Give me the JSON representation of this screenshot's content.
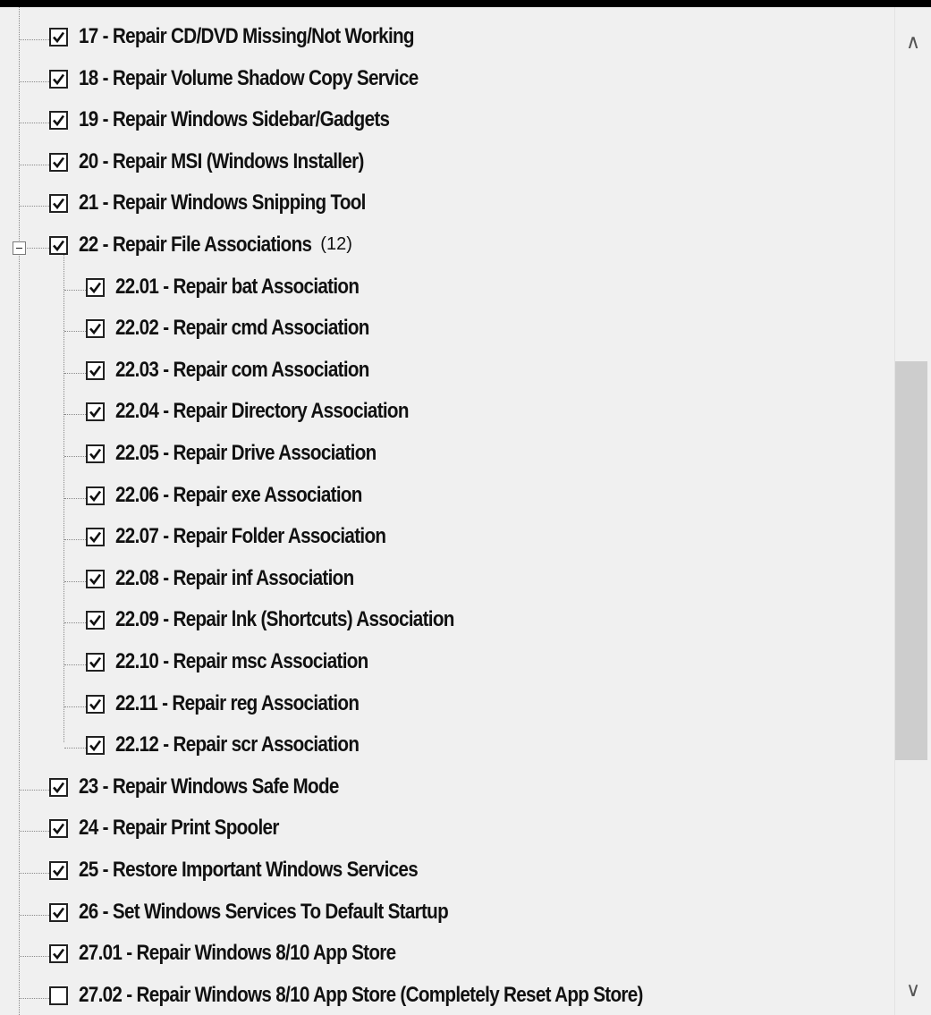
{
  "tree": {
    "items": [
      {
        "label": "17 - Repair CD/DVD Missing/Not Working",
        "checked": true,
        "level": 0
      },
      {
        "label": "18 - Repair Volume Shadow Copy Service",
        "checked": true,
        "level": 0
      },
      {
        "label": "19 - Repair Windows Sidebar/Gadgets",
        "checked": true,
        "level": 0
      },
      {
        "label": "20 - Repair MSI (Windows Installer)",
        "checked": true,
        "level": 0
      },
      {
        "label": "21 - Repair Windows Snipping Tool",
        "checked": true,
        "level": 0
      },
      {
        "label": "22 - Repair File Associations",
        "count": "(12)",
        "checked": true,
        "level": 0,
        "expanded": true
      },
      {
        "label": "22.01 - Repair bat Association",
        "checked": true,
        "level": 1
      },
      {
        "label": "22.02 - Repair cmd Association",
        "checked": true,
        "level": 1
      },
      {
        "label": "22.03 - Repair com Association",
        "checked": true,
        "level": 1
      },
      {
        "label": "22.04 - Repair Directory Association",
        "checked": true,
        "level": 1
      },
      {
        "label": "22.05 - Repair Drive Association",
        "checked": true,
        "level": 1
      },
      {
        "label": "22.06 - Repair exe Association",
        "checked": true,
        "level": 1
      },
      {
        "label": "22.07 - Repair Folder Association",
        "checked": true,
        "level": 1
      },
      {
        "label": "22.08 - Repair inf Association",
        "checked": true,
        "level": 1
      },
      {
        "label": "22.09 - Repair lnk (Shortcuts) Association",
        "checked": true,
        "level": 1
      },
      {
        "label": "22.10 - Repair msc Association",
        "checked": true,
        "level": 1
      },
      {
        "label": "22.11 - Repair reg Association",
        "checked": true,
        "level": 1
      },
      {
        "label": "22.12 - Repair scr Association",
        "checked": true,
        "level": 1
      },
      {
        "label": "23 - Repair Windows Safe Mode",
        "checked": true,
        "level": 0
      },
      {
        "label": "24 - Repair Print Spooler",
        "checked": true,
        "level": 0
      },
      {
        "label": "25 - Restore Important Windows Services",
        "checked": true,
        "level": 0
      },
      {
        "label": "26 - Set Windows Services To Default Startup",
        "checked": true,
        "level": 0
      },
      {
        "label": "27.01 - Repair Windows 8/10 App Store",
        "checked": true,
        "level": 0
      },
      {
        "label": "27.02 - Repair Windows 8/10 App Store (Completely Reset App Store)",
        "checked": false,
        "level": 0
      }
    ]
  },
  "scrollbar": {
    "up_arrow": "∧",
    "down_arrow": "∨",
    "position": 0.45
  }
}
